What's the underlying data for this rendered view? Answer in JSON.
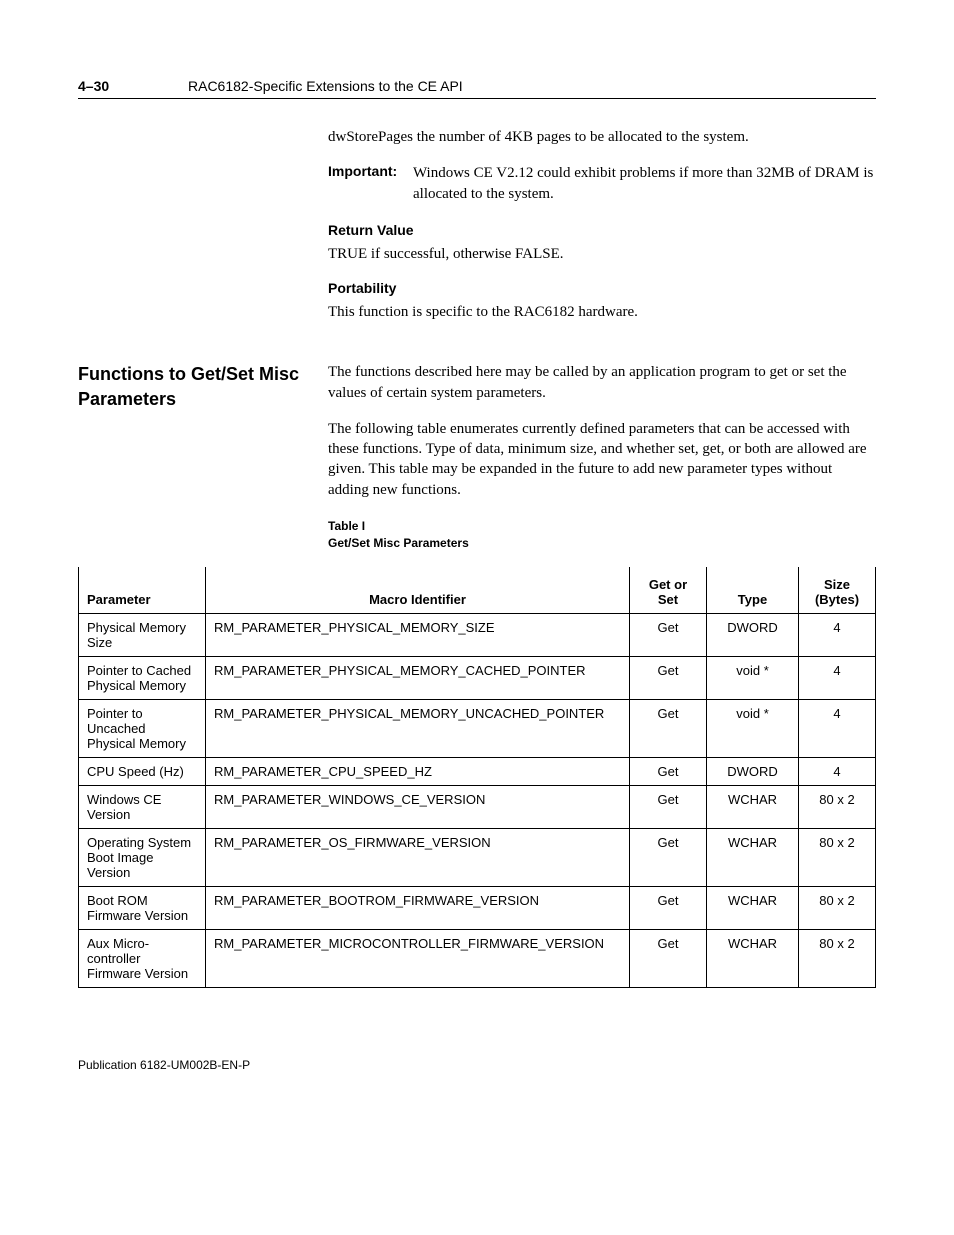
{
  "header": {
    "page_num": "4–30",
    "title": "RAC6182-Specific Extensions to the CE API"
  },
  "intro": {
    "para1": "dwStorePages the number of 4KB pages to be allocated to the system.",
    "important_label": "Important:",
    "important_text": "Windows CE V2.12 could exhibit problems if more than 32MB of DRAM is allocated to the system.",
    "return_heading": "Return Value",
    "return_text": "TRUE if successful, otherwise FALSE.",
    "portability_heading": "Portability",
    "portability_text": "This function is specific to the RAC6182 hardware."
  },
  "section": {
    "heading": "Functions to Get/Set Misc Parameters",
    "para1": "The functions described here may be called by an application program to get or set the values of certain system parameters.",
    "para2": "The following table enumerates currently defined parameters that can be accessed with these functions.  Type of data, minimum size, and whether set, get, or both are allowed are given.  This table may be expanded in the future to add new parameter types without adding new functions.",
    "table_caption_a": "Table I",
    "table_caption_b": "Get/Set Misc Parameters"
  },
  "table": {
    "headers": {
      "parameter": "Parameter",
      "macro": "Macro Identifier",
      "getset": "Get or Set",
      "type": "Type",
      "size": "Size (Bytes)"
    },
    "rows": [
      {
        "parameter": "Physical Memory Size",
        "macro": "RM_PARAMETER_PHYSICAL_MEMORY_SIZE",
        "getset": "Get",
        "type": "DWORD",
        "size": "4"
      },
      {
        "parameter": "Pointer to Cached Physical Memory",
        "macro": "RM_PARAMETER_PHYSICAL_MEMORY_CACHED_POINTER",
        "getset": "Get",
        "type": "void *",
        "size": "4"
      },
      {
        "parameter": "Pointer to Uncached Physical Memory",
        "macro": "RM_PARAMETER_PHYSICAL_MEMORY_UNCACHED_POINTER",
        "getset": "Get",
        "type": "void *",
        "size": "4"
      },
      {
        "parameter": "CPU Speed (Hz)",
        "macro": "RM_PARAMETER_CPU_SPEED_HZ",
        "getset": "Get",
        "type": "DWORD",
        "size": "4"
      },
      {
        "parameter": "Windows CE Version",
        "macro": "RM_PARAMETER_WINDOWS_CE_VERSION",
        "getset": "Get",
        "type": "WCHAR",
        "size": "80 x 2"
      },
      {
        "parameter": "Operating System Boot Image Version",
        "macro": "RM_PARAMETER_OS_FIRMWARE_VERSION",
        "getset": "Get",
        "type": "WCHAR",
        "size": "80 x 2"
      },
      {
        "parameter": "Boot ROM Firmware Version",
        "macro": "RM_PARAMETER_BOOTROM_FIRMWARE_VERSION",
        "getset": "Get",
        "type": "WCHAR",
        "size": "80 x 2"
      },
      {
        "parameter": "Aux Micro-controller Firmware Version",
        "macro": "RM_PARAMETER_MICROCONTROLLER_FIRMWARE_VERSION",
        "getset": "Get",
        "type": "WCHAR",
        "size": "80 x 2"
      }
    ]
  },
  "footer": {
    "text": "Publication 6182-UM002B-EN-P"
  }
}
